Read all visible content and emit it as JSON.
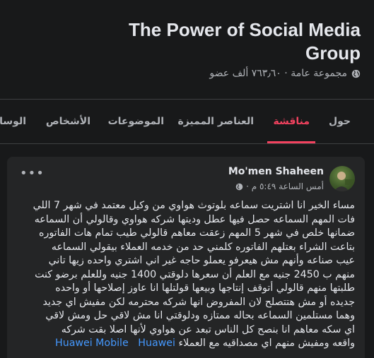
{
  "group": {
    "title": "The Power of Social Media Group",
    "meta": "مجموعة عامة · ٧٦٣٫٦٠ ألف عضو"
  },
  "tabs": [
    {
      "label": "حول"
    },
    {
      "label": "مناقشة",
      "active": true
    },
    {
      "label": "العناصر المميزة"
    },
    {
      "label": "الموضوعات"
    },
    {
      "label": "الأشخاص"
    },
    {
      "label": "الوسا"
    }
  ],
  "post": {
    "author": "Mo'men Shaheen",
    "timestamp": "أمس الساعة ٥:٤٩ م ·",
    "more": "•••",
    "body_lines": [
      "مساء الخير انا اشتريت سماعه بلوتوث هواوي من وكيل معتمد في شهر 7 اللي",
      "فات المهم السماعه حصل فيها عطل وديتها شركه هواوي وقالولي أن السماعه",
      "ضمانها خلص في شهر 5 المهم زعقت معاهم قالولي طيب تمام هات الفاتوره",
      "بتاعت الشراء بعتلهم الفاتوره كلمني حد من خدمه العملاء بيقولي السماعه",
      "عيب صناعه وأنهم مش هيعرفو يعملو حاجه غير اني اشتري واحده زيها تاني",
      "منهم ب 2450 جنيه مع العلم أن سعرها دلوقتي 1400 جنيه وللعلم برضو كنت",
      "طلبتها منهم قالولي أتوقف إنتاجها وبيعها  قولتلها انا  عاوز إصلاحها أو واحده",
      "جديده أو مش هتتصلح  لان المفروض انها شركه محترمه لكن مفيش اي جديد",
      "وهما مستلمين السماعه بحاله ممتازه ودلوقتي انا مش لاقي حل ومش لاقي",
      "اي سكه معاهم انا بنصح كل الناس تبعد عن هواوي لأنها اصلا بقت شركه",
      "واقعه ومفيش منهم اي مصداقيه مع العملاء"
    ],
    "hashtags": [
      "Huawei",
      "Huawei Mobile"
    ]
  },
  "colors": {
    "background": "#18191a",
    "card": "#242526",
    "text_primary": "#e4e6eb",
    "text_secondary": "#b0b3b8",
    "accent_active_tab": "#f3425f",
    "hashtag": "#4599ff"
  }
}
